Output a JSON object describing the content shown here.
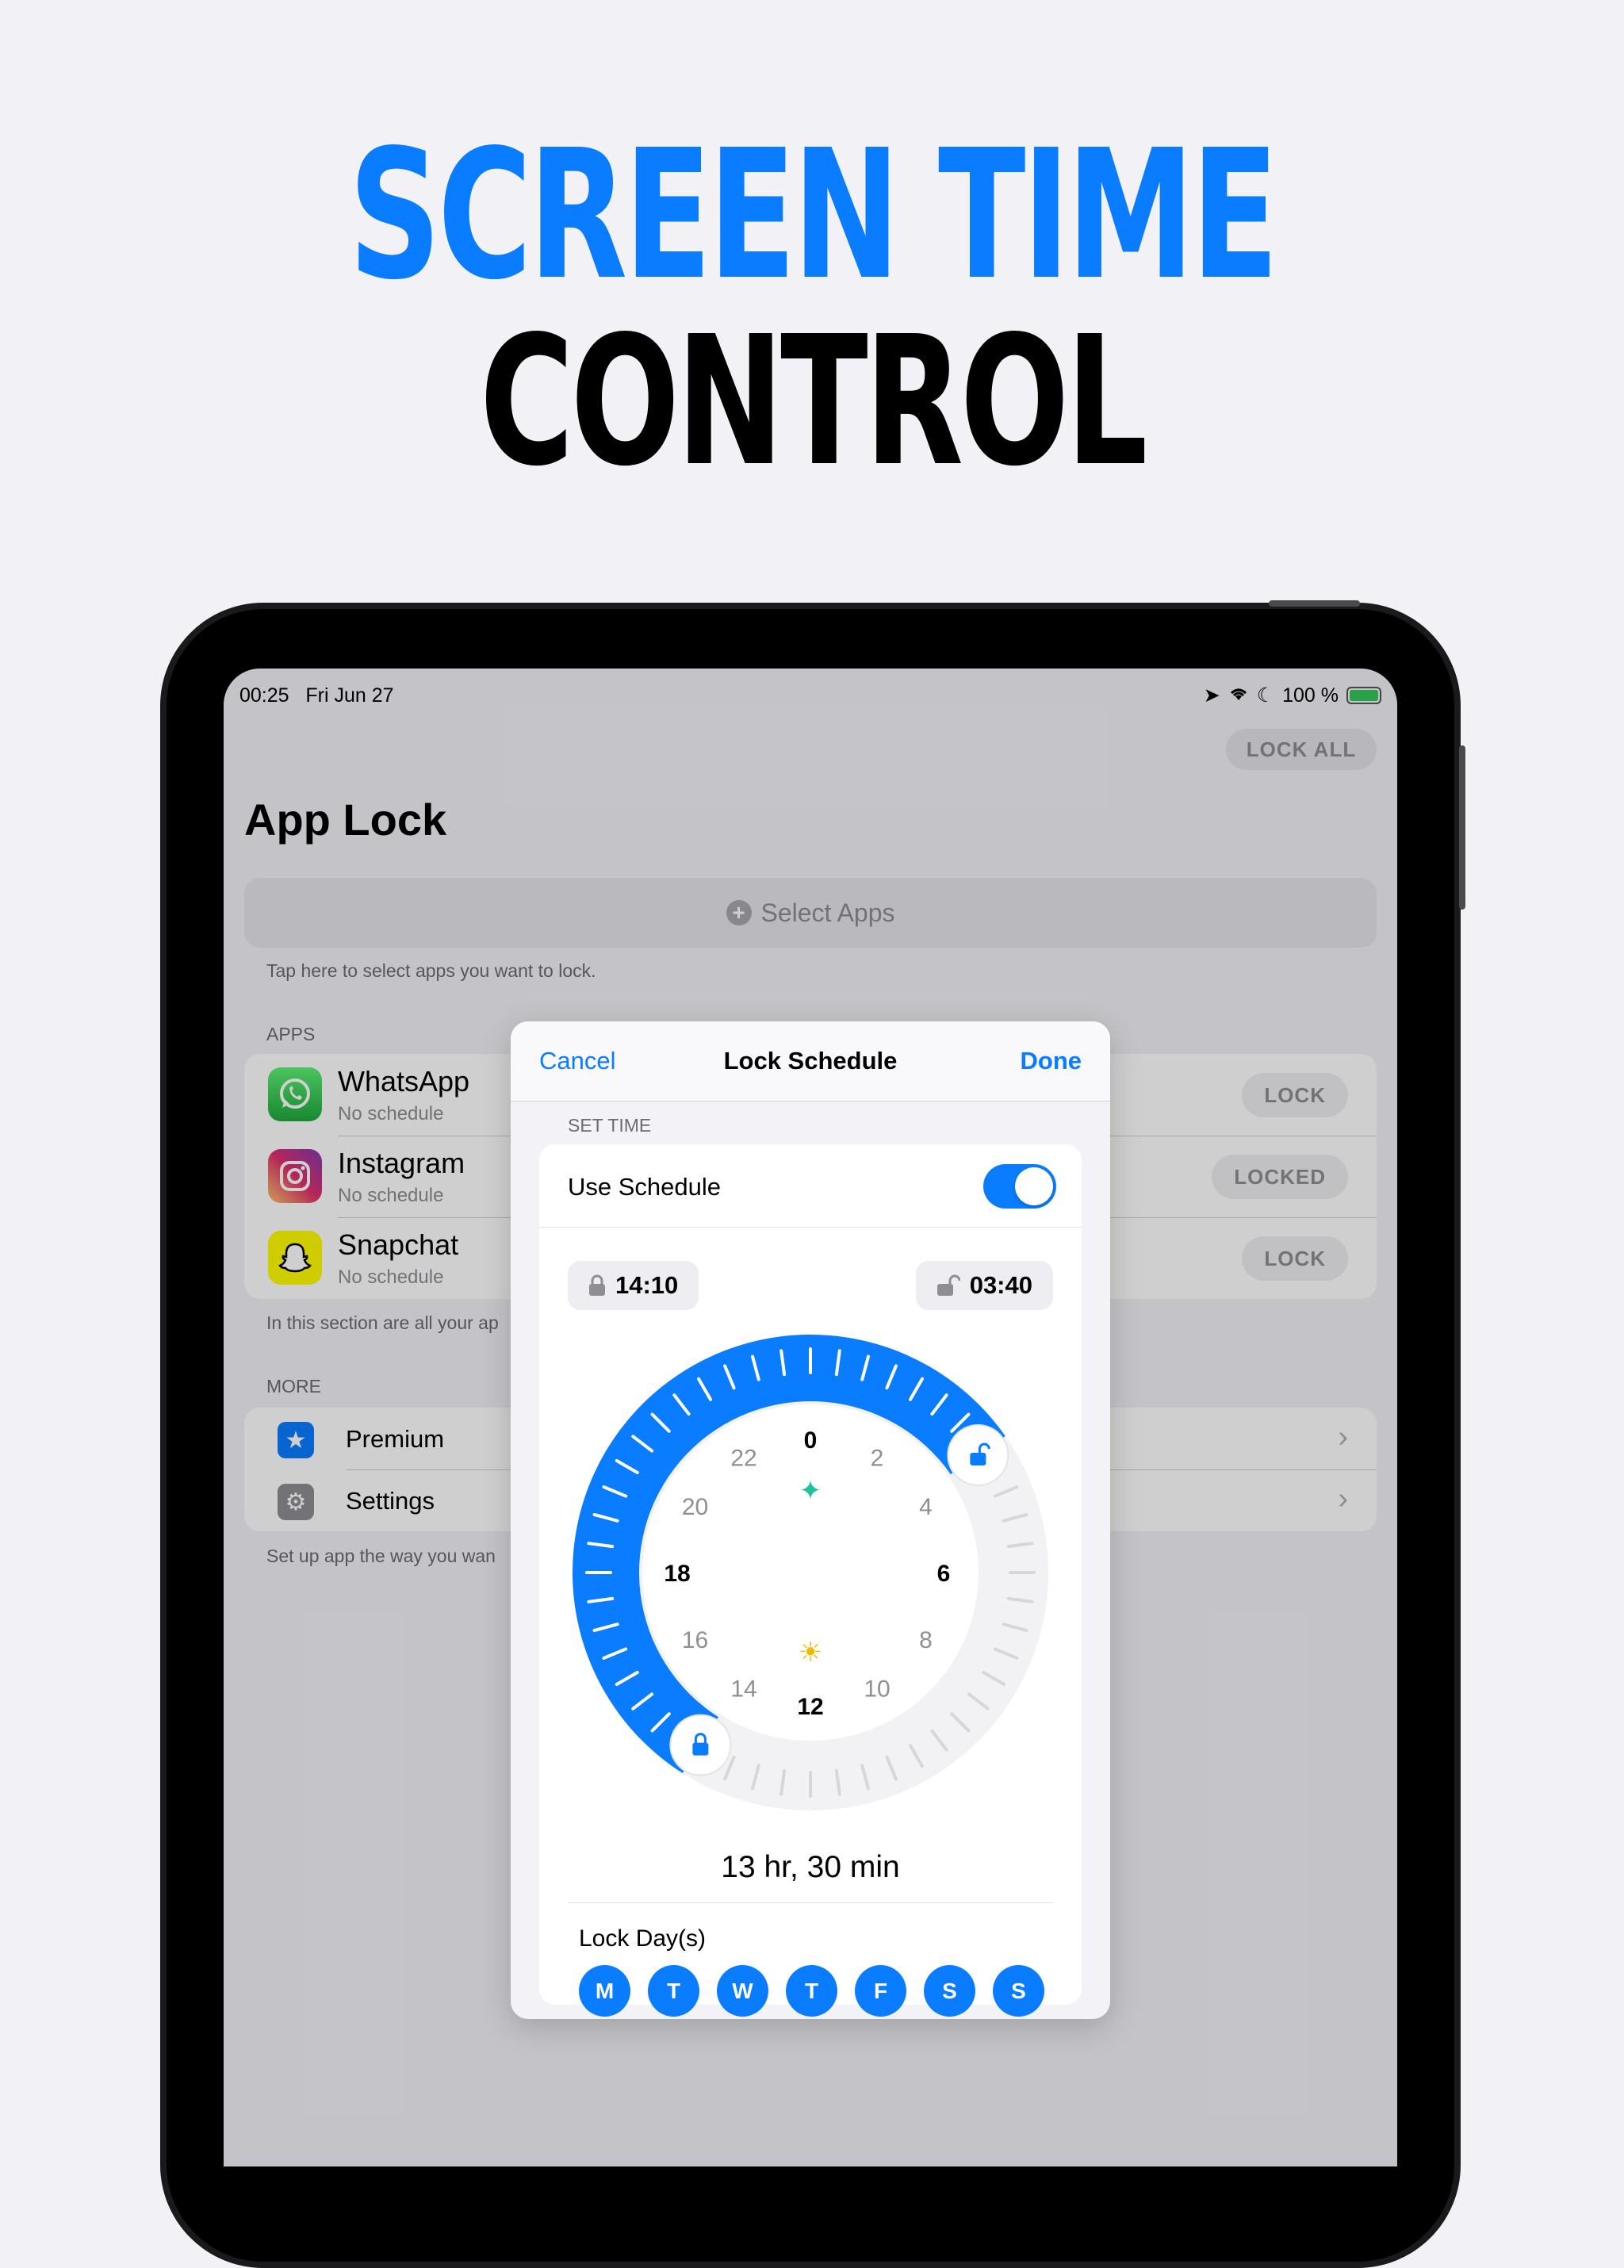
{
  "headline": {
    "line1": "SCREEN TIME",
    "line2": "CONTROL"
  },
  "status_bar": {
    "time": "00:25",
    "date": "Fri Jun 27",
    "battery": "100 %"
  },
  "app": {
    "lock_all": "LOCK ALL",
    "title": "App Lock",
    "select_apps": "Select Apps",
    "select_hint": "Tap here to select apps you want to lock.",
    "apps_header": "APPS",
    "apps": [
      {
        "name": "WhatsApp",
        "sub": "No schedule",
        "button": "LOCK"
      },
      {
        "name": "Instagram",
        "sub": "No schedule",
        "button": "LOCKED"
      },
      {
        "name": "Snapchat",
        "sub": "No schedule",
        "button": "LOCK"
      }
    ],
    "apps_footer": "In this section are all your ap",
    "more_header": "MORE",
    "more": [
      {
        "label": "Premium"
      },
      {
        "label": "Settings"
      }
    ],
    "more_footer": "Set up app the way you wan"
  },
  "modal": {
    "cancel": "Cancel",
    "title": "Lock Schedule",
    "done": "Done",
    "section": "SET TIME",
    "use_schedule": "Use Schedule",
    "use_schedule_on": true,
    "lock_time": "14:10",
    "unlock_time": "03:40",
    "dial_hours": [
      "0",
      "2",
      "4",
      "6",
      "8",
      "10",
      "12",
      "14",
      "16",
      "18",
      "20",
      "22"
    ],
    "duration": "13 hr, 30 min",
    "lock_days_label": "Lock Day(s)",
    "days": [
      "M",
      "T",
      "W",
      "T",
      "F",
      "S",
      "S"
    ]
  },
  "colors": {
    "accent": "#0a7cff",
    "title_black": "#000000",
    "background": "#f2f2f7"
  }
}
